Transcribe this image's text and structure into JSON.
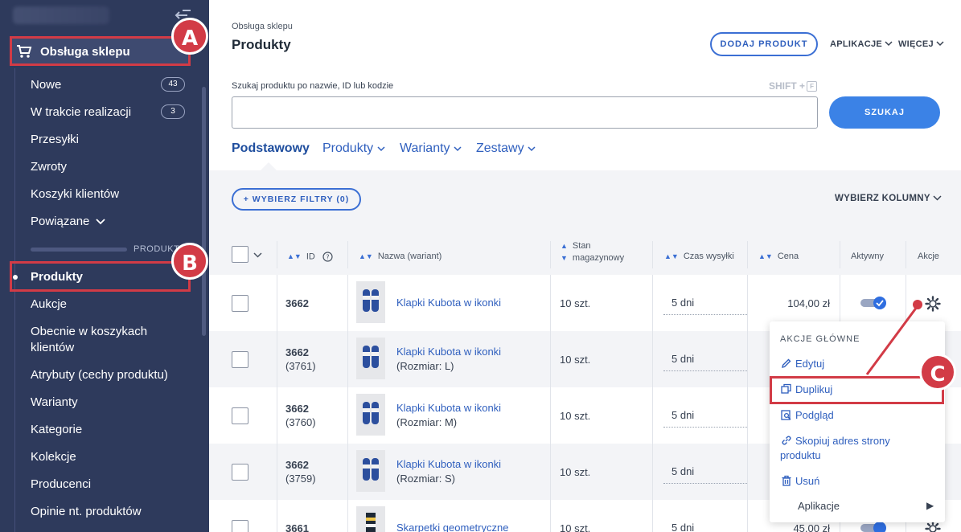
{
  "sidebar": {
    "section_label": "Obsługa sklepu",
    "items": [
      {
        "label": "Nowe",
        "badge": "43"
      },
      {
        "label": "W trakcie realizacji",
        "badge": "3"
      },
      {
        "label": "Przesyłki"
      },
      {
        "label": "Zwroty"
      },
      {
        "label": "Koszyki klientów"
      },
      {
        "label": "Powiązane"
      }
    ],
    "divider_label": "PRODUKTY",
    "product_items": [
      "Produkty",
      "Aukcje",
      "Obecnie w koszykach klientów",
      "Atrybuty (cechy produktu)",
      "Warianty",
      "Kategorie",
      "Kolekcje",
      "Producenci",
      "Opinie nt. produktów"
    ]
  },
  "markers": {
    "a": "A",
    "b": "B",
    "c": "C"
  },
  "header": {
    "breadcrumb": "Obsługa sklepu",
    "title": "Produkty",
    "add_button": "DODAJ PRODUKT",
    "apps_menu": "APLIKACJE",
    "more_menu": "WIĘCEJ"
  },
  "search": {
    "label": "Szukaj produktu po nazwie, ID lub kodzie",
    "shortcut": "SHIFT +",
    "shortcut_key": "F",
    "value": "",
    "button": "SZUKAJ"
  },
  "tabs": [
    "Podstawowy",
    "Produkty",
    "Warianty",
    "Zestawy"
  ],
  "filters": {
    "add_filter": "+ WYBIERZ FILTRY (0)",
    "columns": "WYBIERZ KOLUMNY"
  },
  "table": {
    "headers": {
      "id": "ID",
      "name": "Nazwa (wariant)",
      "stock_1": "Stan",
      "stock_2": "magazynowy",
      "shipping": "Czas wysyłki",
      "price": "Cena",
      "active": "Aktywny",
      "actions": "Akcje"
    },
    "rows": [
      {
        "id": "3662",
        "sub": "",
        "name": "Klapki Kubota w ikonki",
        "variant": "",
        "stock": "10 szt.",
        "shipping": "5 dni",
        "price": "104,00 zł"
      },
      {
        "id": "3662",
        "sub": "(3761)",
        "name": "Klapki Kubota w ikonki",
        "variant": "(Rozmiar: L)",
        "stock": "10 szt.",
        "shipping": "5 dni",
        "price": ""
      },
      {
        "id": "3662",
        "sub": "(3760)",
        "name": "Klapki Kubota w ikonki",
        "variant": "(Rozmiar: M)",
        "stock": "10 szt.",
        "shipping": "5 dni",
        "price": ""
      },
      {
        "id": "3662",
        "sub": "(3759)",
        "name": "Klapki Kubota w ikonki",
        "variant": "(Rozmiar: S)",
        "stock": "10 szt.",
        "shipping": "5 dni",
        "price": ""
      },
      {
        "id": "3661",
        "sub": "",
        "name": "Skarpetki geometryczne",
        "variant": "",
        "stock": "10 szt.",
        "shipping": "5 dni",
        "price": "45,00 zł"
      }
    ]
  },
  "popup": {
    "heading": "AKCJE GŁÓWNE",
    "edit": "Edytuj",
    "duplicate": "Duplikuj",
    "preview": "Podgląd",
    "copy_url_1": "Skopiuj adres strony",
    "copy_url_2": "produktu",
    "delete": "Usuń",
    "apps": "Aplikacje"
  },
  "colors": {
    "sidebar_bg": "#2e3a5c",
    "accent": "#3b82e6",
    "highlight": "#d23b46"
  }
}
